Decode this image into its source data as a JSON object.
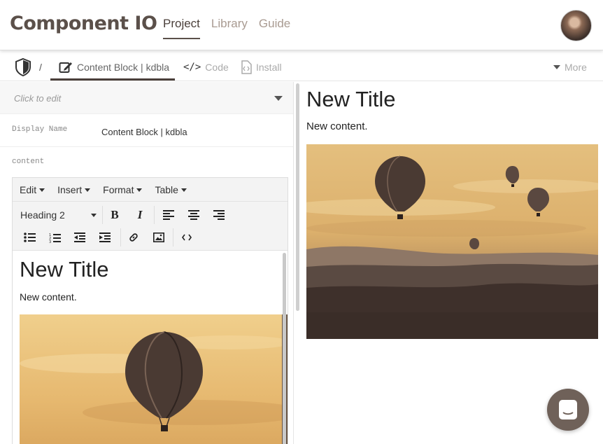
{
  "header": {
    "logo": "Component IO",
    "nav": [
      {
        "label": "Project",
        "active": true
      },
      {
        "label": "Library",
        "active": false
      },
      {
        "label": "Guide",
        "active": false
      }
    ],
    "avatar_icon": "user-avatar"
  },
  "subnav": {
    "home_icon": "shield-icon",
    "separator": "/",
    "tabs": [
      {
        "label": "Content Block | kdbla",
        "icon": "edit-icon",
        "active": true
      },
      {
        "label": "Code",
        "icon": "code-icon",
        "active": false
      },
      {
        "label": "Install",
        "icon": "file-code-icon",
        "active": false
      }
    ],
    "more_label": "More"
  },
  "left": {
    "click_to_edit": "Click to edit",
    "display_name_label": "Display Name",
    "display_name_value": "Content Block | kdbla",
    "content_label": "content",
    "editor": {
      "menu": [
        "Edit",
        "Insert",
        "Format",
        "Table"
      ],
      "block_format": "Heading 2",
      "title": "New Title",
      "body": "New content."
    }
  },
  "preview": {
    "title": "New Title",
    "body": "New content."
  },
  "colors": {
    "brand": "#5b504a",
    "nav_inactive": "#a99b92",
    "chat_button": "#6f6159",
    "photo_sky": "#e8bf7a"
  }
}
